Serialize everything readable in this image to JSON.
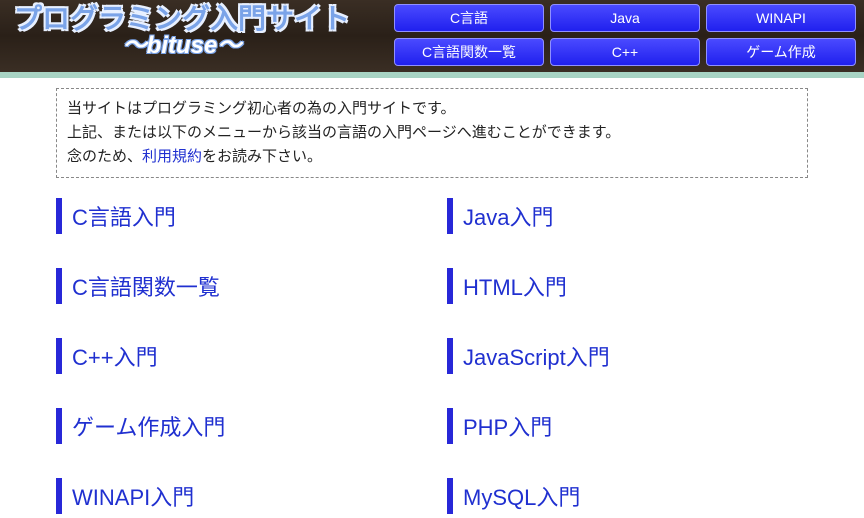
{
  "header": {
    "title": "プログラミング入門サイト",
    "subtitle": "〜bituse〜",
    "nav": [
      {
        "label": "C言語"
      },
      {
        "label": "Java"
      },
      {
        "label": "WINAPI"
      },
      {
        "label": "C言語関数一覧"
      },
      {
        "label": "C++"
      },
      {
        "label": "ゲーム作成"
      }
    ]
  },
  "intro": {
    "line1": "当サイトはプログラミング初心者の為の入門サイトです。",
    "line2": "上記、または以下のメニューから該当の言語の入門ページへ進むことができます。",
    "line3_prefix": "念のため、",
    "line3_link": "利用規約",
    "line3_suffix": "をお読み下さい。"
  },
  "languages": {
    "left": [
      {
        "label": "C言語入門"
      },
      {
        "label": "C言語関数一覧"
      },
      {
        "label": "C++入門"
      },
      {
        "label": "ゲーム作成入門"
      },
      {
        "label": "WINAPI入門"
      }
    ],
    "right": [
      {
        "label": "Java入門"
      },
      {
        "label": "HTML入門"
      },
      {
        "label": "JavaScript入門"
      },
      {
        "label": "PHP入門"
      },
      {
        "label": "MySQL入門"
      }
    ]
  }
}
